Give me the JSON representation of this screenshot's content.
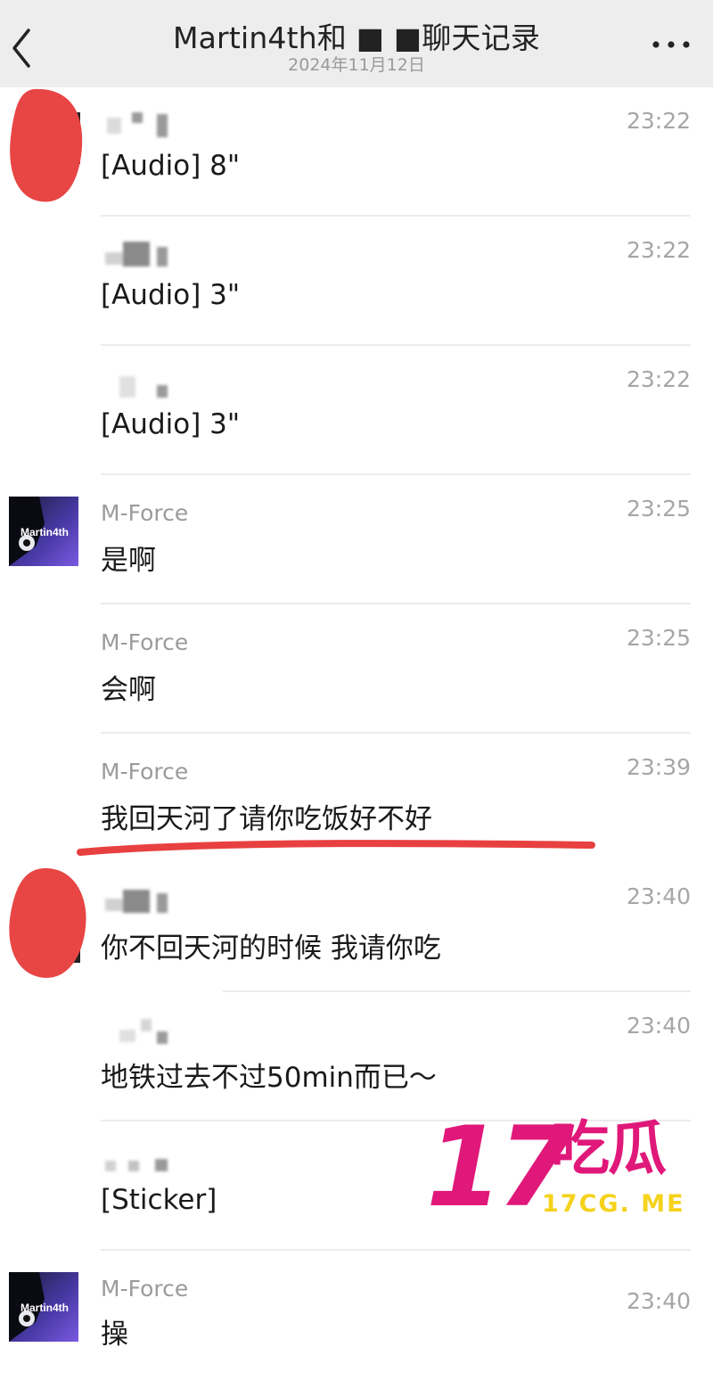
{
  "header": {
    "title": "Martin4th和 ■ ■聊天记录",
    "subtitle": "2024年11月12日"
  },
  "icons": {
    "back": "back-chevron-icon",
    "more": "more-ellipsis-icon"
  },
  "records": [
    {
      "sender": "",
      "time": "23:22",
      "message": "[Audio]  8\"",
      "avatar": "redacted"
    },
    {
      "sender": "",
      "time": "23:22",
      "message": "[Audio]  3\"",
      "avatar": "none"
    },
    {
      "sender": "",
      "time": "23:22",
      "message": "[Audio]  3\"",
      "avatar": "none"
    },
    {
      "sender": "M-Force",
      "time": "23:25",
      "message": "是啊",
      "avatar": "martin4th"
    },
    {
      "sender": "M-Force",
      "time": "23:25",
      "message": "会啊",
      "avatar": "none"
    },
    {
      "sender": "M-Force",
      "time": "23:39",
      "message": "我回天河了请你吃饭好不好",
      "avatar": "none"
    },
    {
      "sender": "",
      "time": "23:40",
      "message": "你不回天河的时候 我请你吃",
      "avatar": "redacted"
    },
    {
      "sender": "",
      "time": "23:40",
      "message": "地铁过去不过50min而已～",
      "avatar": "none"
    },
    {
      "sender": "",
      "time": "",
      "message": "[Sticker]",
      "avatar": "none"
    },
    {
      "sender": "M-Force",
      "time": "23:40",
      "message": "操",
      "avatar": "martin4th"
    }
  ],
  "avatar_label": "Martin4th",
  "watermark": {
    "number": "17",
    "chinese": "吃瓜",
    "domain": "17CG. ME"
  },
  "colors": {
    "header_bg": "#ededed",
    "annotation_red": "#e84040",
    "watermark_pink": "#e0187a",
    "watermark_yellow": "#f5d21c"
  }
}
